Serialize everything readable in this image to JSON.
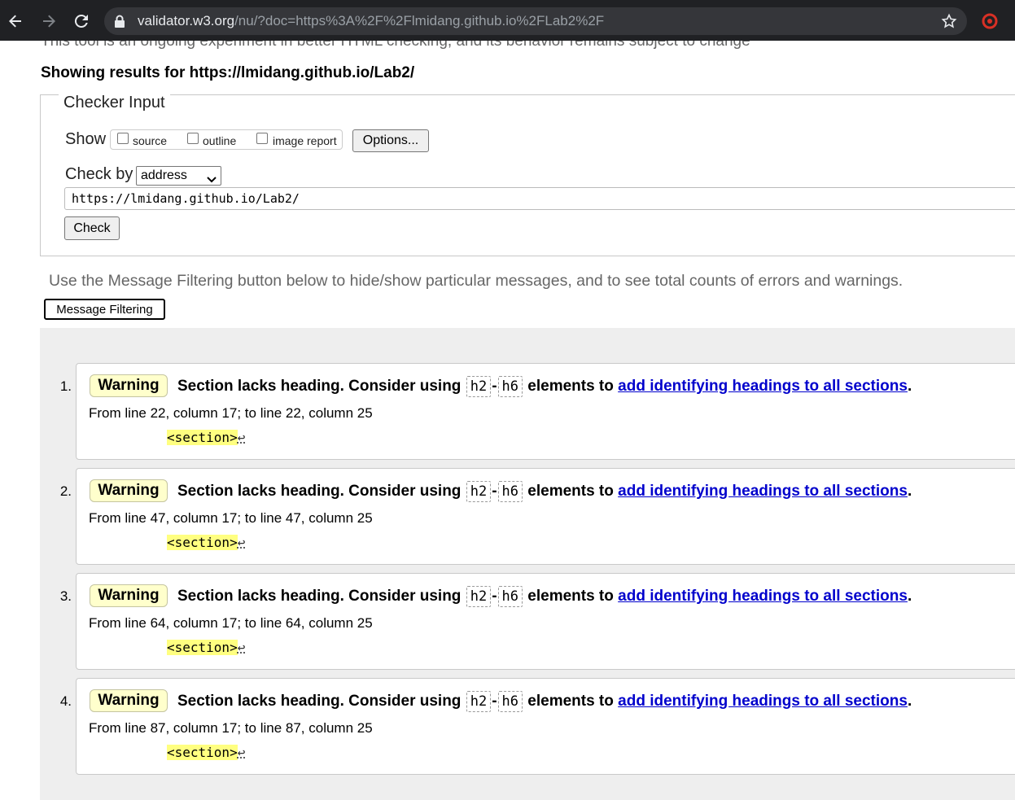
{
  "browser": {
    "url_host": "validator.w3.org",
    "url_rest": "/nu/?doc=https%3A%2F%2Flmidang.github.io%2FLab2%2F"
  },
  "page": {
    "cut_text": "This tool is an ongoing experiment in better HTML checking, and its behavior remains subject to change",
    "showing_results": "Showing results for https://lmidang.github.io/Lab2/",
    "checker": {
      "legend": "Checker Input",
      "show_label": "Show",
      "options": [
        "source",
        "outline",
        "image report"
      ],
      "options_button": "Options...",
      "check_by_label": "Check by",
      "check_by_value": "address",
      "url_value": "https://lmidang.github.io/Lab2/",
      "check_button": "Check"
    },
    "filter_note": "Use the Message Filtering button below to hide/show particular messages, and to see total counts of errors and warnings.",
    "filter_button": "Message Filtering",
    "messages": [
      {
        "num": "1.",
        "type": "Warning",
        "text_a": "Section lacks heading. Consider using",
        "code1": "h2",
        "dash": "-",
        "code2": "h6",
        "text_b": "elements to",
        "link": "add identifying headings to all sections",
        "end": ".",
        "location": "From line 22, column 17; to line 22, column 25",
        "extract": "<section>",
        "lf": "↩"
      },
      {
        "num": "2.",
        "type": "Warning",
        "text_a": "Section lacks heading. Consider using",
        "code1": "h2",
        "dash": "-",
        "code2": "h6",
        "text_b": "elements to",
        "link": "add identifying headings to all sections",
        "end": ".",
        "location": "From line 47, column 17; to line 47, column 25",
        "extract": "<section>",
        "lf": "↩"
      },
      {
        "num": "3.",
        "type": "Warning",
        "text_a": "Section lacks heading. Consider using",
        "code1": "h2",
        "dash": "-",
        "code2": "h6",
        "text_b": "elements to",
        "link": "add identifying headings to all sections",
        "end": ".",
        "location": "From line 64, column 17; to line 64, column 25",
        "extract": "<section>",
        "lf": "↩"
      },
      {
        "num": "4.",
        "type": "Warning",
        "text_a": "Section lacks heading. Consider using",
        "code1": "h2",
        "dash": "-",
        "code2": "h6",
        "text_b": "elements to",
        "link": "add identifying headings to all sections",
        "end": ".",
        "location": "From line 87, column 17; to line 87, column 25",
        "extract": "<section>",
        "lf": "↩"
      }
    ]
  }
}
